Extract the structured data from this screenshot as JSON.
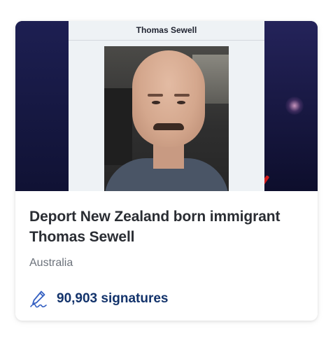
{
  "card": {
    "image": {
      "caption_name": "Thomas Sewell"
    },
    "title": "Deport New Zealand born immigrant Thomas Sewell",
    "location": "Australia",
    "signatures": {
      "icon": "pen-signature-icon",
      "label": "90,903 signatures"
    }
  },
  "colors": {
    "title": "#2a2d33",
    "location": "#6c727b",
    "signature_text": "#13336b",
    "signature_icon": "#3560c2"
  }
}
